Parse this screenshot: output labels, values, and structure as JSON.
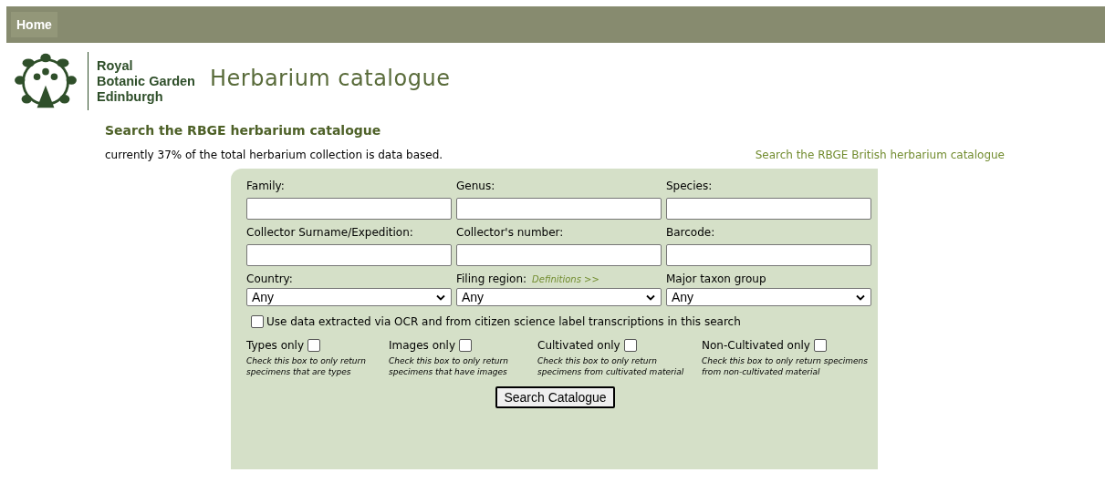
{
  "nav": {
    "items": [
      {
        "label": "Home",
        "selected": true
      }
    ]
  },
  "header": {
    "org_lines": [
      "Royal",
      "Botanic Garden",
      "Edinburgh"
    ],
    "title": "Herbarium catalogue"
  },
  "intro": {
    "heading": "Search the RBGE herbarium catalogue",
    "note": "currently 37% of the total herbarium collection is data based.",
    "link": "Search the RBGE British herbarium catalogue"
  },
  "form": {
    "fields": [
      {
        "kind": "text",
        "label": "Family:"
      },
      {
        "kind": "text",
        "label": "Genus:"
      },
      {
        "kind": "text",
        "label": "Species:"
      },
      {
        "kind": "text",
        "label": "Collector Surname/Expedition:"
      },
      {
        "kind": "text",
        "label": "Collector's number:"
      },
      {
        "kind": "text",
        "label": "Barcode:"
      },
      {
        "kind": "select",
        "label": "Country:",
        "value": "Any"
      },
      {
        "kind": "select",
        "label": "Filing region:",
        "link": "Definitions >>",
        "value": "Any"
      },
      {
        "kind": "select",
        "label": "Major taxon group",
        "value": "Any"
      }
    ],
    "ocr": {
      "label": "Use data extracted via OCR and from citizen science label transcriptions in this search",
      "checked": false
    },
    "filters": [
      {
        "label": "Types only",
        "checked": false,
        "hint": "Check this box to only return specimens that are types"
      },
      {
        "label": "Images only",
        "checked": false,
        "hint": "Check this box to only return specimens that have images"
      },
      {
        "label": "Cultivated only",
        "checked": false,
        "hint": "Check this box to only return specimens from cultivated material"
      },
      {
        "label": "Non-Cultivated only",
        "checked": false,
        "hint": "Check this box to only return specimens from non-cultivated material"
      }
    ],
    "submit": "Search Catalogue"
  }
}
